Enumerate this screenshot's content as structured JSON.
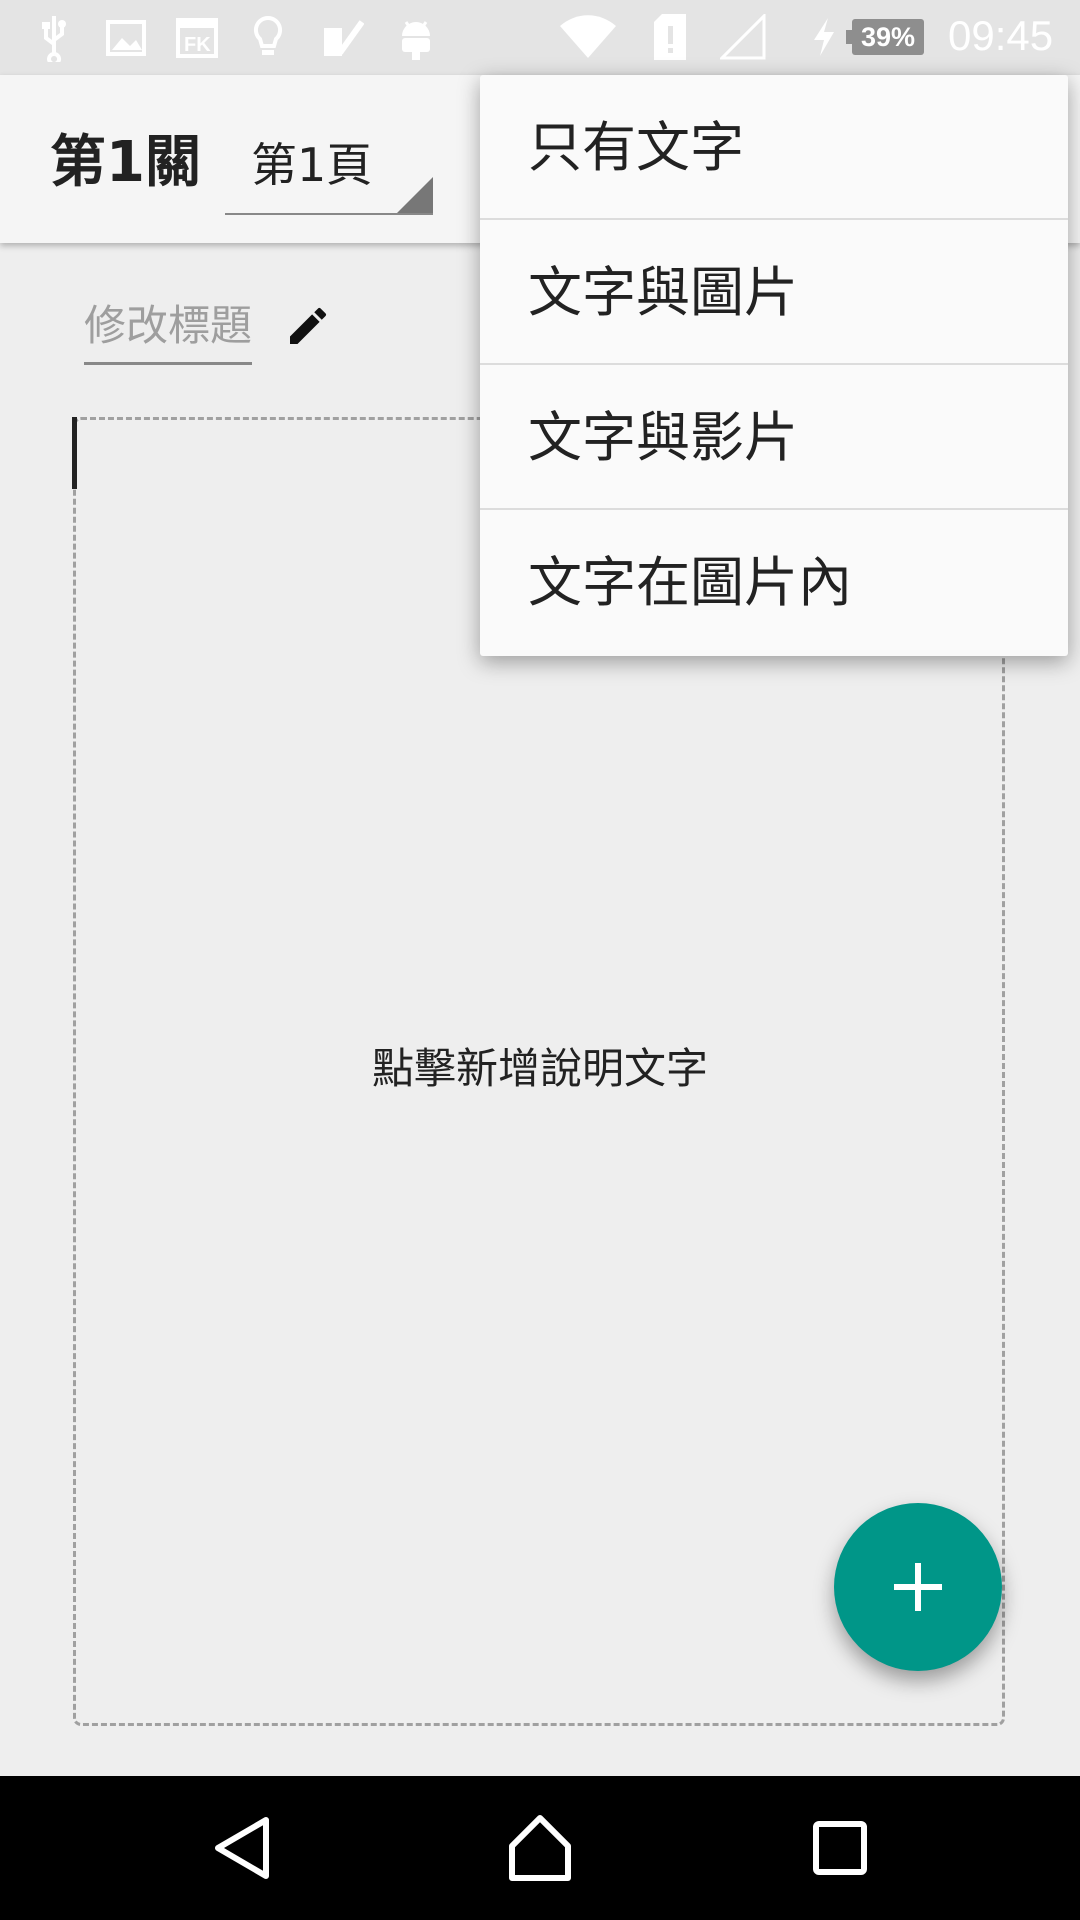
{
  "status_bar": {
    "battery": "39%",
    "time": "09:45"
  },
  "app_bar": {
    "level_title": "第1關",
    "page_selector_value": "第1頁"
  },
  "editor": {
    "title_placeholder": "修改標題",
    "hint_text": "點擊新增說明文字"
  },
  "dropdown": {
    "items": [
      "只有文字",
      "文字與圖片",
      "文字與影片",
      "文字在圖片內"
    ]
  },
  "colors": {
    "accent": "#009688",
    "background": "#eeeeee",
    "menu_background": "#fafafa"
  },
  "icons": {
    "fab": "plus-icon",
    "edit": "pencil-icon"
  }
}
